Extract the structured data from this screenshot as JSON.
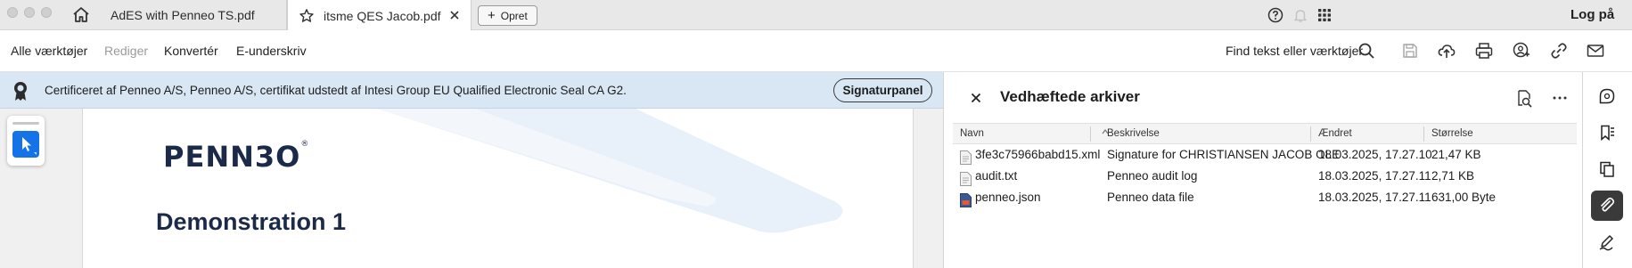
{
  "tabs": {
    "inactive_label": "AdES with Penneo TS.pdf",
    "active_label": "itsme QES Jacob.pdf",
    "new_tab_label": "Opret"
  },
  "header": {
    "login_label": "Log på"
  },
  "menu": {
    "items": [
      "Alle værktøjer",
      "Rediger",
      "Konvertér",
      "E-underskriv"
    ],
    "find_label": "Find tekst eller værktøjer"
  },
  "banner": {
    "text": "Certificeret af  Penneo A/S, Penneo A/S, certifikat udstedt af Intesi Group EU Qualified Electronic Seal CA G2.",
    "button_label": "Signaturpanel"
  },
  "document": {
    "logo_text": "PENN3O",
    "logo_mark": "®",
    "title": "Demonstration 1"
  },
  "attachments": {
    "title": "Vedhæftede arkiver",
    "columns": [
      "Navn",
      "Beskrivelse",
      "Ændret",
      "Størrelse"
    ],
    "rows": [
      {
        "name": "3fe3c75966babd15.xml",
        "description": "Signature for CHRISTIANSEN JACOB OLE",
        "modified": "18.03.2025, 17.27.10",
        "size": "21,47 KB",
        "icon": "document-icon"
      },
      {
        "name": "audit.txt",
        "description": "Penneo audit log",
        "modified": "18.03.2025, 17.27.11",
        "size": "2,71 KB",
        "icon": "document-icon"
      },
      {
        "name": "penneo.json",
        "description": "Penneo data file",
        "modified": "18.03.2025, 17.27.11",
        "size": "631,00 Byte",
        "icon": "json-file-icon"
      }
    ]
  },
  "colors": {
    "banner_bg": "#d9e7f5",
    "accent_blue": "#1473e6",
    "brand_navy": "#1c2a4a"
  }
}
